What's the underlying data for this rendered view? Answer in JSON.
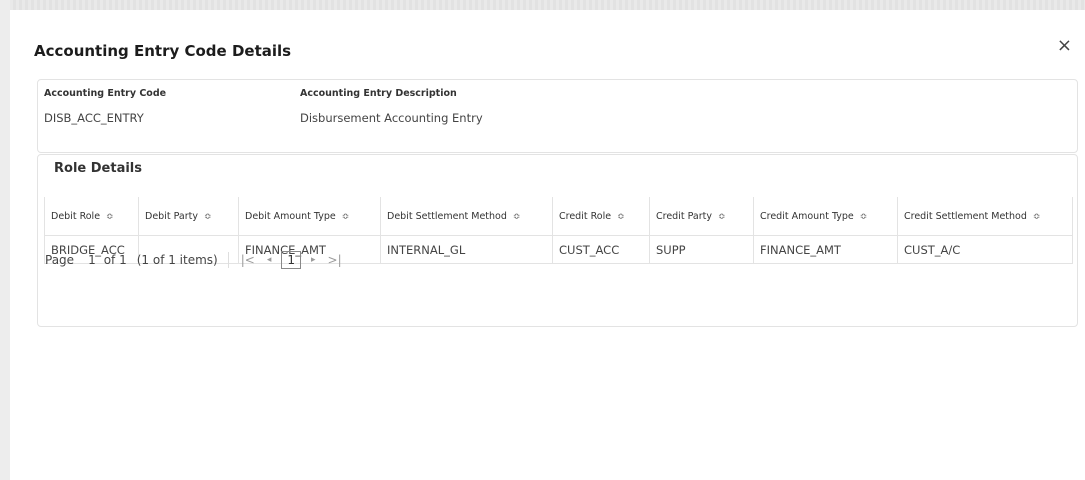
{
  "modal": {
    "title": "Accounting Entry Code Details",
    "close_label": "×"
  },
  "info": {
    "code_label": "Accounting Entry Code",
    "code_value": "DISB_ACC_ENTRY",
    "desc_label": "Accounting Entry Description",
    "desc_value": "Disbursement Accounting Entry"
  },
  "roles": {
    "title": "Role Details",
    "columns": [
      "Debit Role",
      "Debit Party",
      "Debit Amount Type",
      "Debit Settlement Method",
      "Credit Role",
      "Credit Party",
      "Credit Amount Type",
      "Credit Settlement Method"
    ],
    "rows": [
      [
        "BRIDGE_ACC",
        "",
        "FINANCE_AMT",
        "INTERNAL_GL",
        "CUST_ACC",
        "SUPP",
        "FINANCE_AMT",
        "CUST_A/C"
      ]
    ],
    "sort_icon": "sort-icon"
  },
  "pagination": {
    "page_label": "Page",
    "page_value": "1",
    "of_label": "of 1",
    "items_label": "(1 of 1 items)",
    "first_icon": "|<",
    "prev_icon": "◂",
    "current_page": "1",
    "next_icon": "▸",
    "last_icon": ">|"
  }
}
